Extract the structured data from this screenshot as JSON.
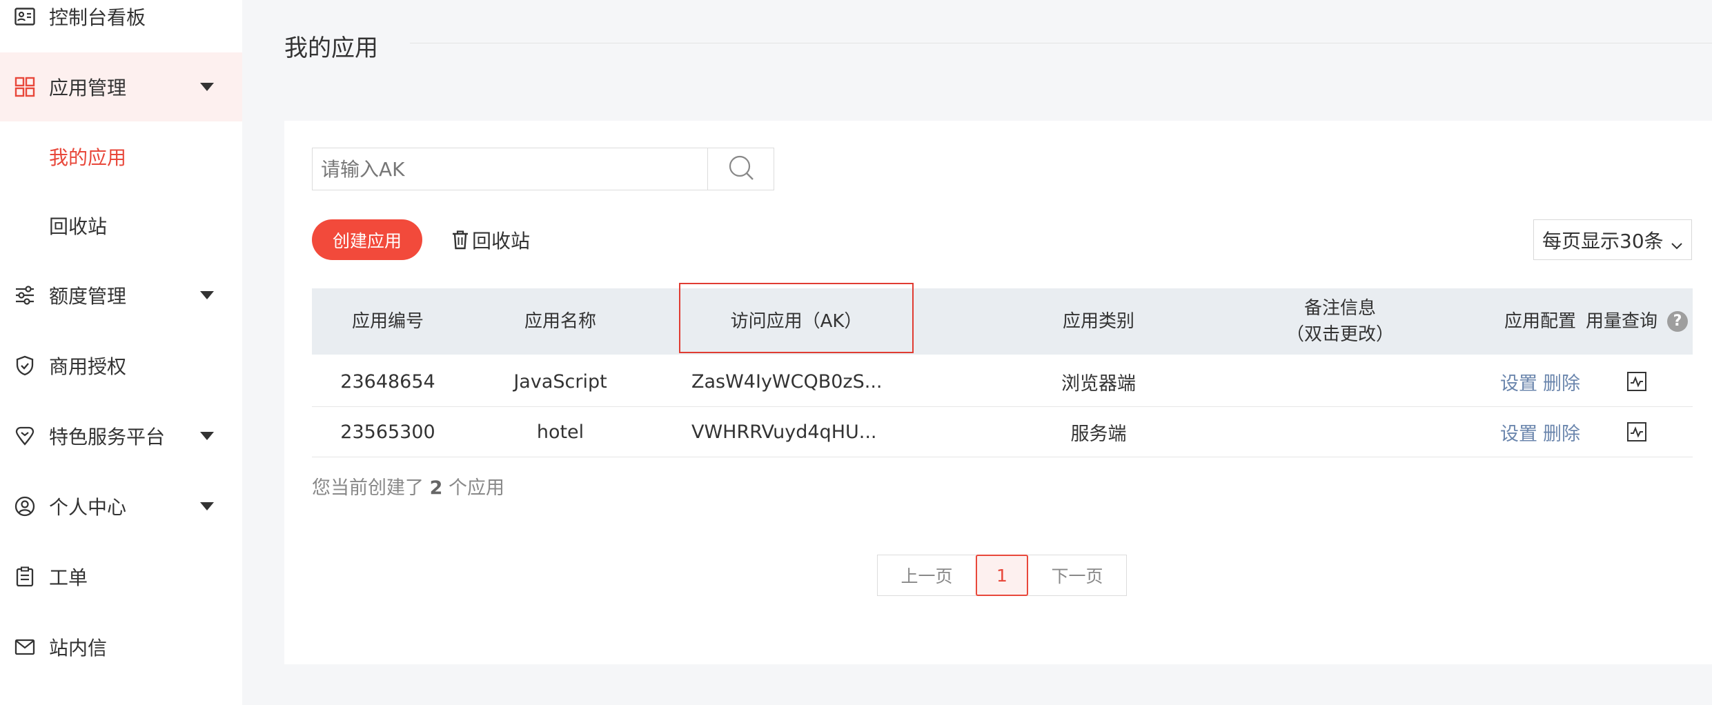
{
  "sidebar": {
    "items": [
      {
        "label": "控制台看板",
        "icon": "id-card-icon"
      },
      {
        "label": "应用管理",
        "icon": "grid-icon"
      },
      {
        "label": "额度管理",
        "icon": "sliders-icon"
      },
      {
        "label": "商用授权",
        "icon": "shield-icon"
      },
      {
        "label": "特色服务平台",
        "icon": "diamond-icon"
      },
      {
        "label": "个人中心",
        "icon": "user-circle-icon"
      },
      {
        "label": "工单",
        "icon": "clipboard-icon"
      },
      {
        "label": "站内信",
        "icon": "mail-icon"
      }
    ],
    "sub_items": [
      {
        "label": "我的应用",
        "active": true
      },
      {
        "label": "回收站",
        "active": false
      }
    ]
  },
  "main": {
    "title": "我的应用",
    "search": {
      "placeholder": "请输入AK",
      "value": ""
    },
    "create_label": "创建应用",
    "recycle_label": "回收站",
    "page_size_label": "每页显示30条"
  },
  "table": {
    "headers": {
      "id": "应用编号",
      "name": "应用名称",
      "ak": "访问应用（AK）",
      "type": "应用类别",
      "remark_line1": "备注信息",
      "remark_line2": "（双击更改）",
      "config": "应用配置",
      "usage": "用量查询"
    },
    "rows": [
      {
        "id": "23648654",
        "name": "JavaScript",
        "ak": "ZasW4IyWCQB0zS...",
        "type": "浏览器端",
        "remark": "",
        "set": "设置",
        "del": "删除"
      },
      {
        "id": "23565300",
        "name": "hotel",
        "ak": "VWHRRVuyd4qHU...",
        "type": "服务端",
        "remark": "",
        "set": "设置",
        "del": "删除"
      }
    ]
  },
  "summary": {
    "prefix": "您当前创建了",
    "count": "2",
    "suffix": "个应用"
  },
  "pagination": {
    "prev": "上一页",
    "current": "1",
    "next": "下一页"
  },
  "colors": {
    "accent": "#f24a3b",
    "link": "#6b86ad",
    "highlight_border": "#e03c32"
  }
}
